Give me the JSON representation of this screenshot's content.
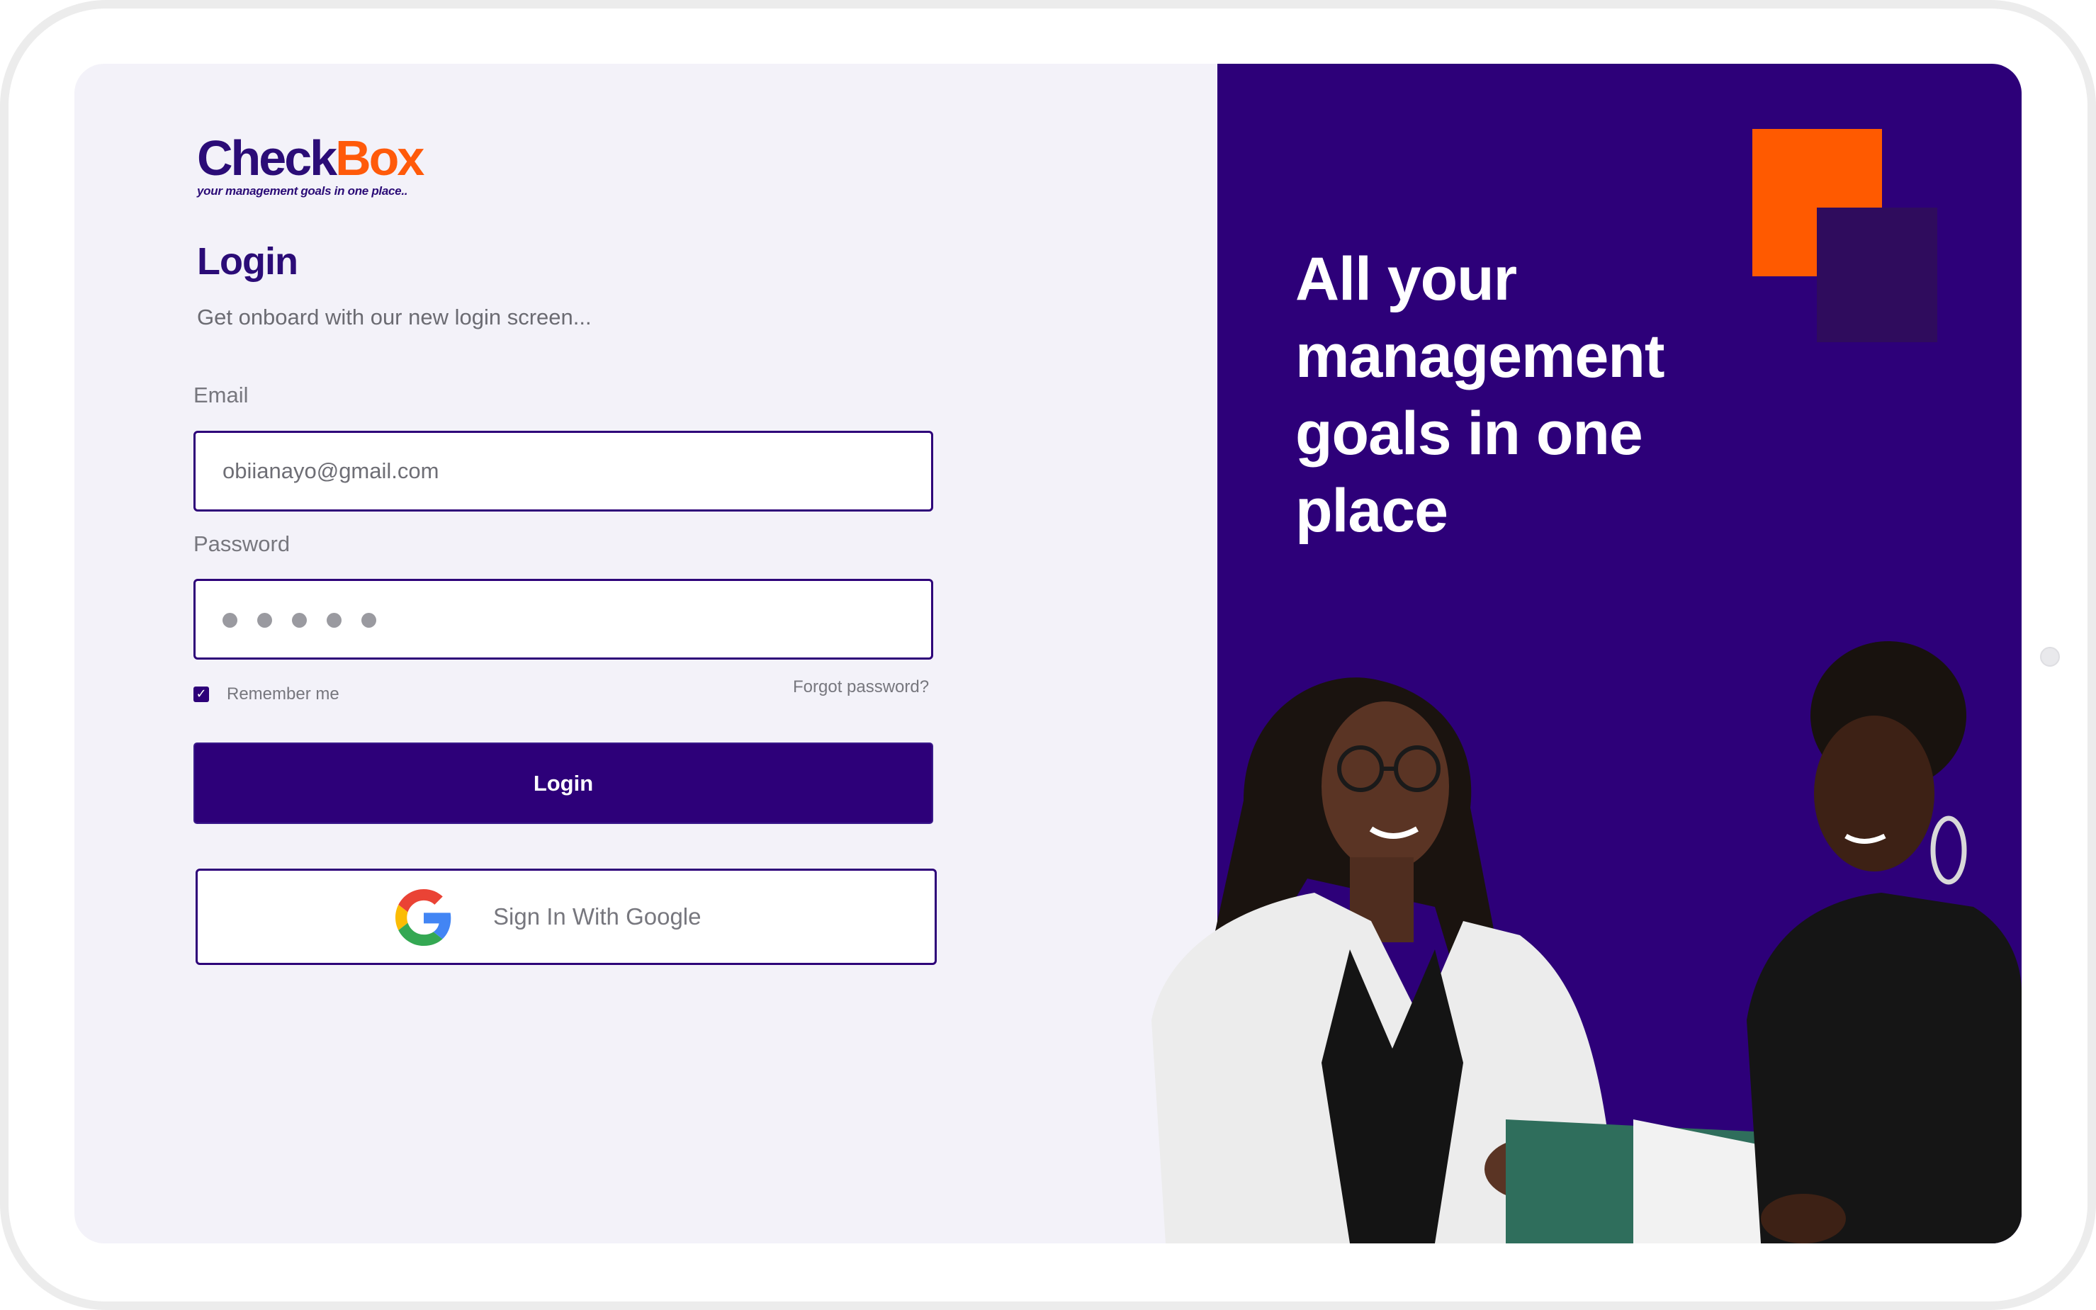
{
  "logo": {
    "check": "Check",
    "box": "Box",
    "tagline": "your management goals in one place.."
  },
  "login": {
    "title": "Login",
    "subtitle": "Get onboard with our new login screen...",
    "email_label": "Email",
    "email_value": "obiianayo@gmail.com",
    "password_label": "Password",
    "password_dots": 5,
    "remember_label": "Remember me",
    "remember_checked": true,
    "forgot_label": "Forgot password?",
    "login_button": "Login",
    "google_button": "Sign In With Google"
  },
  "hero": {
    "headline": "All your management goals in one place"
  },
  "colors": {
    "brand_purple": "#2d0079",
    "brand_orange": "#ff5a00",
    "panel_bg": "#f3f2f9"
  },
  "icons": {
    "google": "google-g-icon",
    "checkbox": "checkmark-icon"
  }
}
